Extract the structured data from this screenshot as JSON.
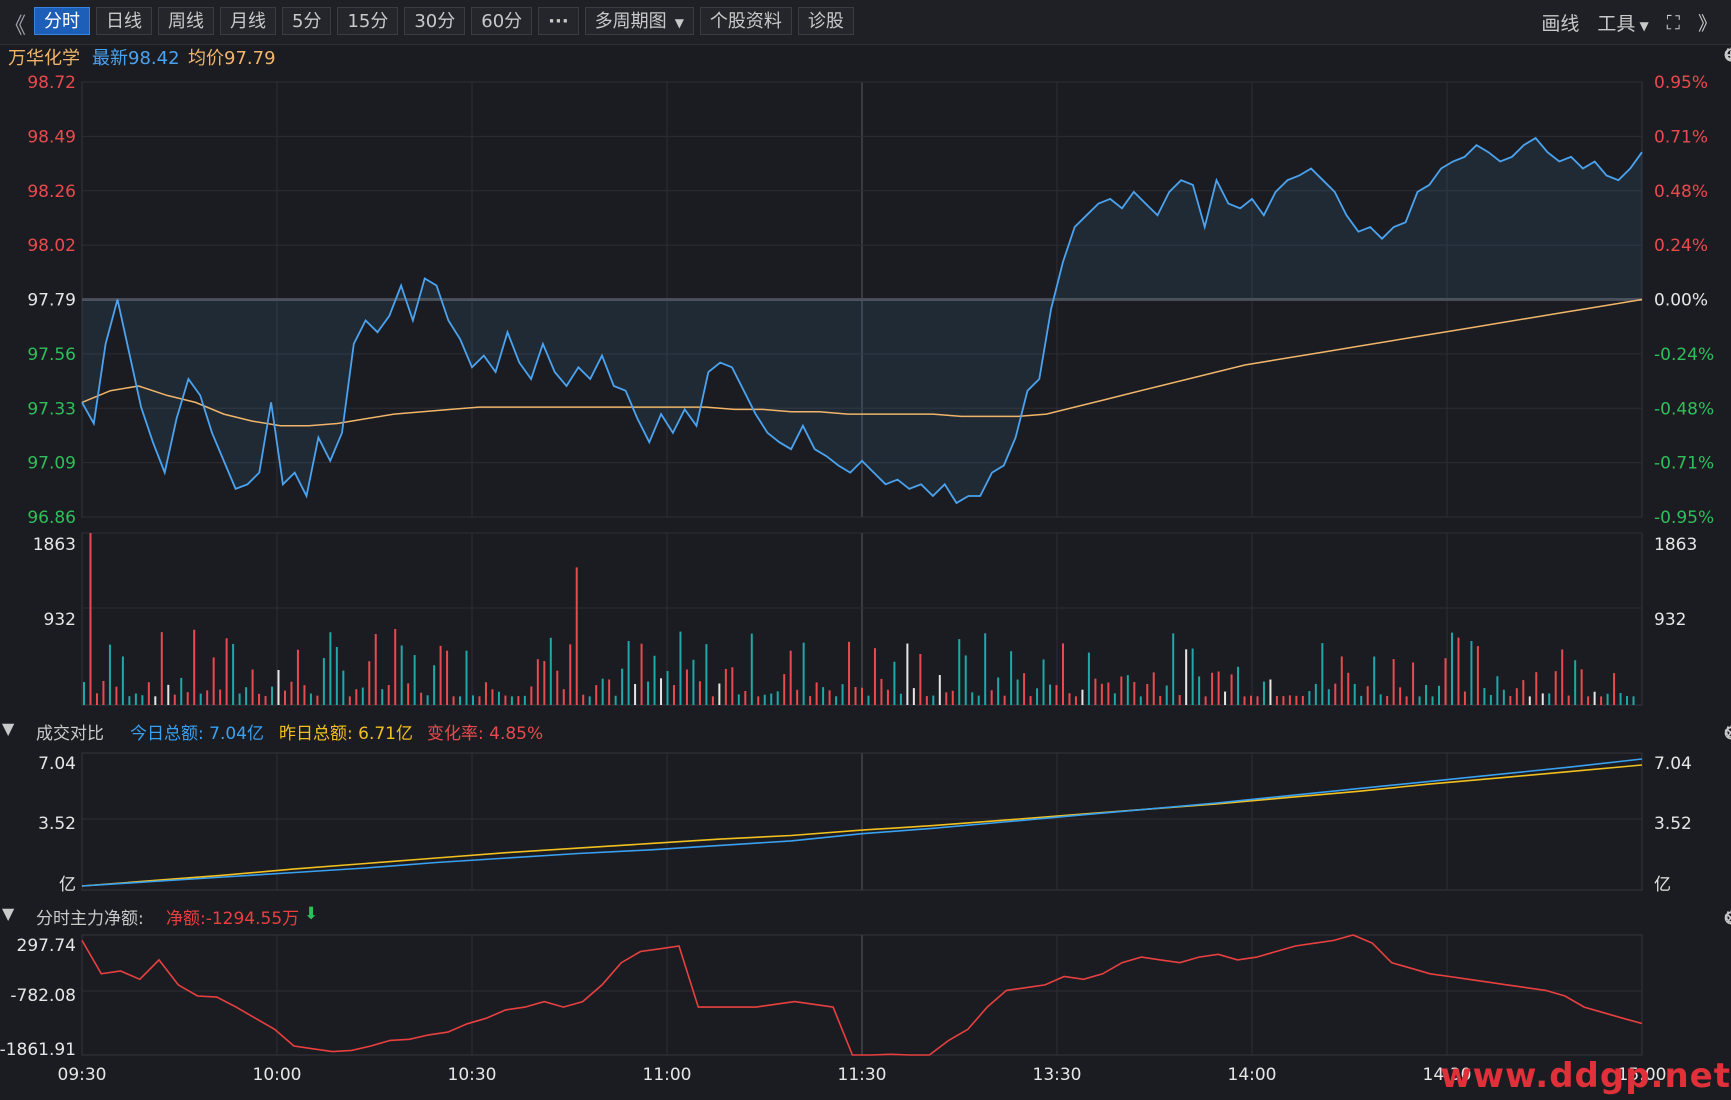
{
  "toolbar": {
    "back_glyph": "《",
    "forward_glyph": "》",
    "periods": [
      "分时",
      "日线",
      "周线",
      "月线",
      "5分",
      "15分",
      "30分",
      "60分",
      "···",
      "多周期图",
      "个股资料",
      "诊股"
    ],
    "active_period": "分时",
    "draw_label": "画线",
    "tools_label": "工具",
    "tools_caret": "▼",
    "fullscreen_glyph": "⛶"
  },
  "stock": {
    "name": "万华化学",
    "latest": "最新98.42",
    "avg": "均价97.79"
  },
  "main_icons": [
    "↺",
    "⊕",
    "⊖",
    "⚙"
  ],
  "price_panel": {
    "left_ticks": [
      "98.72",
      "98.49",
      "98.26",
      "98.02",
      "97.79",
      "97.56",
      "97.33",
      "97.09",
      "96.86"
    ],
    "right_ticks": [
      "0.95%",
      "0.71%",
      "0.48%",
      "0.24%",
      "0.00%",
      "-0.24%",
      "-0.48%",
      "-0.71%",
      "-0.95%"
    ],
    "prev_close": 97.79
  },
  "volume_panel": {
    "left_ticks": [
      "1863",
      "932"
    ],
    "right_ticks": [
      "1863",
      "932"
    ]
  },
  "turnover_panel": {
    "title": "成交对比",
    "today": "今日总额: 7.04亿",
    "yesterday": "昨日总额: 6.71亿",
    "change": "变化率: 4.85%",
    "left_ticks": [
      "7.04",
      "3.52",
      "亿"
    ],
    "right_ticks": [
      "7.04",
      "3.52",
      "亿"
    ]
  },
  "mainforce_panel": {
    "title": "分时主力净额:",
    "net": "净额:-1294.55万",
    "arrow": "⬇",
    "left_ticks": [
      "297.74",
      "-782.08",
      "-1861.91"
    ]
  },
  "time_axis": [
    "09:30",
    "10:00",
    "10:30",
    "11:00",
    "11:30",
    "13:30",
    "14:00",
    "14:30",
    "15:00"
  ],
  "watermark": "www.ddgp.net",
  "colors": {
    "price_line": "#4aa3f0",
    "avg_line": "#f0b56a",
    "up": "#e84a4f",
    "down": "#1ea8a8",
    "green_text": "#2fbf5a",
    "today_line": "#3aa0f0",
    "yesterday_line": "#f0c020",
    "net_line": "#e84040"
  },
  "chart_data": [
    {
      "type": "line",
      "series": [
        {
          "name": "最新",
          "values": [
            97.35,
            97.26,
            97.6,
            97.79,
            97.56,
            97.33,
            97.18,
            97.05,
            97.28,
            97.45,
            97.38,
            97.22,
            97.1,
            96.98,
            97.0,
            97.05,
            97.35,
            97.0,
            97.05,
            96.95,
            97.2,
            97.1,
            97.22,
            97.6,
            97.7,
            97.65,
            97.72,
            97.85,
            97.7,
            97.88,
            97.85,
            97.7,
            97.62,
            97.5,
            97.55,
            97.48,
            97.65,
            97.52,
            97.45,
            97.6,
            97.48,
            97.42,
            97.5,
            97.45,
            97.55,
            97.42,
            97.4,
            97.28,
            97.18,
            97.3,
            97.22,
            97.32,
            97.25,
            97.48,
            97.52,
            97.5,
            97.4,
            97.3,
            97.22,
            97.18,
            97.15,
            97.25,
            97.15,
            97.12,
            97.08,
            97.05,
            97.1,
            97.05,
            97.0,
            97.02,
            96.98,
            97.0,
            96.95,
            97.0,
            96.92,
            96.95,
            96.95,
            97.05,
            97.08,
            97.2,
            97.4,
            97.45,
            97.75,
            97.95,
            98.1,
            98.15,
            98.2,
            98.22,
            98.18,
            98.25,
            98.2,
            98.15,
            98.25,
            98.3,
            98.28,
            98.1,
            98.3,
            98.2,
            98.18,
            98.22,
            98.15,
            98.25,
            98.3,
            98.32,
            98.35,
            98.3,
            98.25,
            98.15,
            98.08,
            98.1,
            98.05,
            98.1,
            98.12,
            98.25,
            98.28,
            98.35,
            98.38,
            98.4,
            98.45,
            98.42,
            98.38,
            98.4,
            98.45,
            98.48,
            98.42,
            98.38,
            98.4,
            98.35,
            98.38,
            98.32,
            98.3,
            98.35,
            98.42
          ]
        },
        {
          "name": "均价",
          "values": [
            97.35,
            97.4,
            97.42,
            97.38,
            97.35,
            97.3,
            97.27,
            97.25,
            97.25,
            97.26,
            97.28,
            97.3,
            97.31,
            97.32,
            97.33,
            97.33,
            97.33,
            97.33,
            97.33,
            97.33,
            97.33,
            97.33,
            97.33,
            97.32,
            97.32,
            97.31,
            97.31,
            97.3,
            97.3,
            97.3,
            97.3,
            97.29,
            97.29,
            97.29,
            97.3,
            97.33,
            97.36,
            97.39,
            97.42,
            97.45,
            97.48,
            97.51,
            97.53,
            97.55,
            97.57,
            97.59,
            97.61,
            97.63,
            97.65,
            97.67,
            97.69,
            97.71,
            97.73,
            97.75,
            97.77,
            97.79
          ]
        }
      ],
      "ylim": [
        96.86,
        98.72
      ]
    },
    {
      "type": "line",
      "series": [
        {
          "name": "今日总额",
          "values": [
            0.0,
            0.25,
            0.5,
            0.75,
            1.0,
            1.3,
            1.55,
            1.8,
            2.0,
            2.25,
            2.5,
            2.9,
            3.2,
            3.55,
            3.9,
            4.25,
            4.6,
            5.0,
            5.4,
            5.8,
            6.2,
            6.6,
            7.04
          ]
        },
        {
          "name": "昨日总额",
          "values": [
            0.0,
            0.3,
            0.6,
            0.95,
            1.25,
            1.55,
            1.85,
            2.1,
            2.35,
            2.6,
            2.8,
            3.1,
            3.35,
            3.65,
            3.95,
            4.25,
            4.55,
            4.9,
            5.25,
            5.65,
            6.0,
            6.35,
            6.71
          ]
        }
      ],
      "ylim": [
        0,
        7.04
      ]
    },
    {
      "type": "line",
      "series": [
        {
          "name": "净额",
          "values": [
            200,
            -400,
            -350,
            -500,
            -150,
            -600,
            -800,
            -820,
            -1000,
            -1200,
            -1400,
            -1700,
            -1750,
            -1800,
            -1780,
            -1700,
            -1600,
            -1580,
            -1500,
            -1450,
            -1300,
            -1200,
            -1050,
            -1000,
            -900,
            -1000,
            -900,
            -600,
            -200,
            0,
            50,
            100,
            -1000,
            -1000,
            -1000,
            -1000,
            -950,
            -900,
            -950,
            -1000,
            -1950,
            -1950,
            -1850,
            -1950,
            -2000,
            -1600,
            -1400,
            -1000,
            -700,
            -650,
            -600,
            -450,
            -500,
            -400,
            -200,
            -100,
            -150,
            -200,
            -100,
            -50,
            -150,
            -100,
            0,
            100,
            150,
            200,
            300,
            150,
            -200,
            -300,
            -400,
            -450,
            -500,
            -550,
            -600,
            -650,
            -700,
            -800,
            -1000,
            -1100,
            -1200,
            -1294.55
          ]
        }
      ],
      "ylim": [
        -1861.91,
        297.74
      ]
    }
  ]
}
